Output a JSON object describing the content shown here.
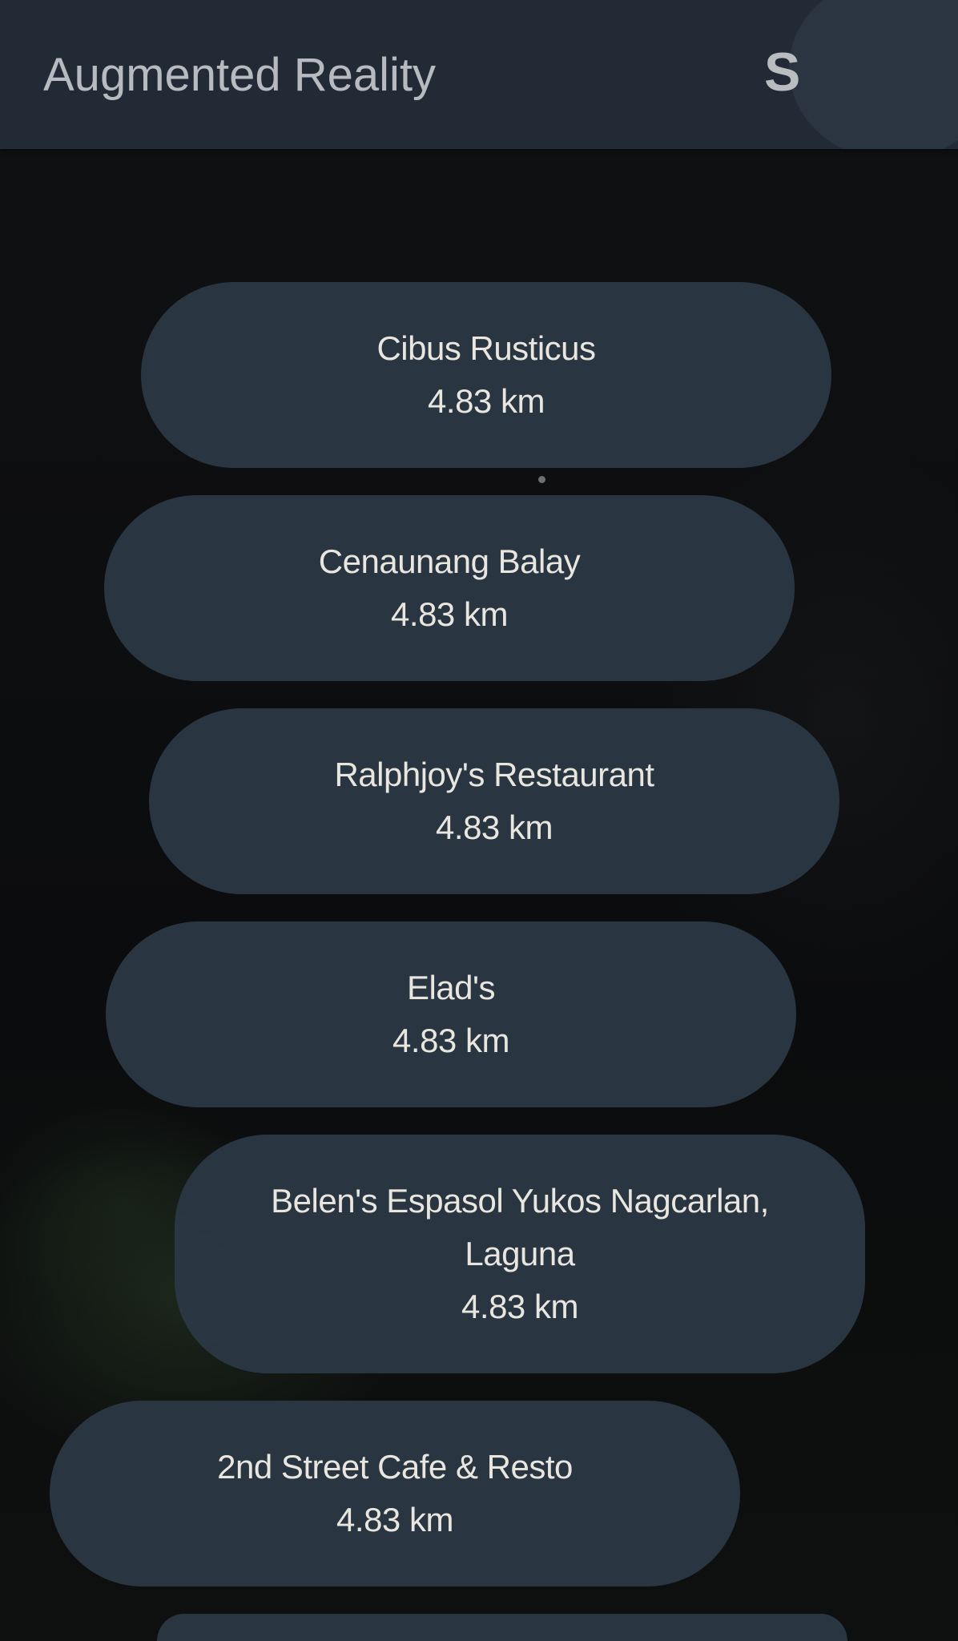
{
  "app_bar": {
    "title": "Augmented Reality",
    "avatar_letter": "S"
  },
  "markers": [
    {
      "name": "Cibus Rusticus",
      "distance": "4.83 km"
    },
    {
      "name": "Cenaunang Balay",
      "distance": "4.83 km"
    },
    {
      "name": "Ralphjoy's Restaurant",
      "distance": "4.83 km"
    },
    {
      "name": "Elad's",
      "distance": "4.83 km"
    },
    {
      "name": "Belen's Espasol Yukos Nagcarlan, Laguna",
      "distance": "4.83 km"
    },
    {
      "name": "2nd Street Cafe & Resto",
      "distance": "4.83 km"
    }
  ],
  "colors": {
    "app_bar": "#222b35",
    "marker_bg": "#2b3744",
    "marker_text": "#e9e6df",
    "title_text": "#b7bbbf"
  }
}
